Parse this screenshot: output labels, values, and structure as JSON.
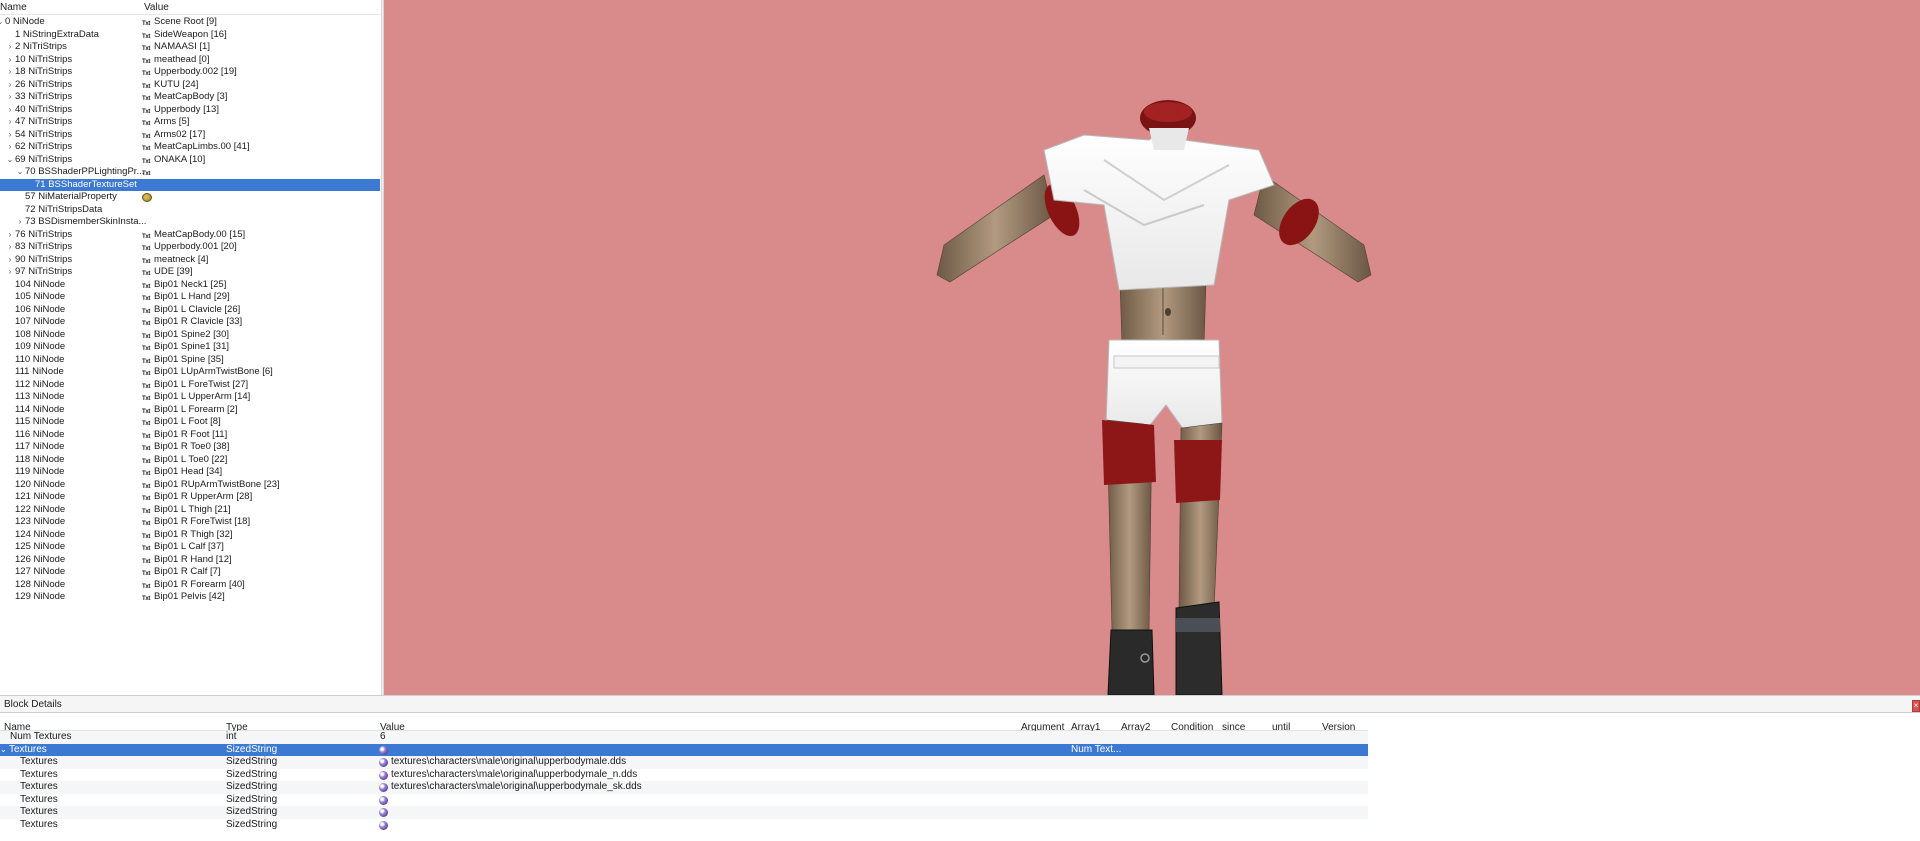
{
  "tree": {
    "columns": {
      "name": "Name",
      "value": "Value"
    },
    "rows": [
      {
        "name": "0 NiNode",
        "value": "Scene Root [9]",
        "expander": "open",
        "indent": 0,
        "icon": "txt"
      },
      {
        "name": "1 NiStringExtraData",
        "value": "SideWeapon [16]",
        "expander": "",
        "indent": 1,
        "icon": "txt"
      },
      {
        "name": "2 NiTriStrips",
        "value": "NAMAASI [1]",
        "expander": "closed",
        "indent": 1,
        "icon": "txt"
      },
      {
        "name": "10 NiTriStrips",
        "value": "meathead [0]",
        "expander": "closed",
        "indent": 1,
        "icon": "txt"
      },
      {
        "name": "18 NiTriStrips",
        "value": "Upperbody.002 [19]",
        "expander": "closed",
        "indent": 1,
        "icon": "txt"
      },
      {
        "name": "26 NiTriStrips",
        "value": "KUTU [24]",
        "expander": "closed",
        "indent": 1,
        "icon": "txt"
      },
      {
        "name": "33 NiTriStrips",
        "value": "MeatCapBody [3]",
        "expander": "closed",
        "indent": 1,
        "icon": "txt"
      },
      {
        "name": "40 NiTriStrips",
        "value": "Upperbody [13]",
        "expander": "closed",
        "indent": 1,
        "icon": "txt"
      },
      {
        "name": "47 NiTriStrips",
        "value": "Arms [5]",
        "expander": "closed",
        "indent": 1,
        "icon": "txt"
      },
      {
        "name": "54 NiTriStrips",
        "value": "Arms02 [17]",
        "expander": "closed",
        "indent": 1,
        "icon": "txt"
      },
      {
        "name": "62 NiTriStrips",
        "value": "MeatCapLimbs.00 [41]",
        "expander": "closed",
        "indent": 1,
        "icon": "txt"
      },
      {
        "name": "69 NiTriStrips",
        "value": "ONAKA [10]",
        "expander": "open",
        "indent": 1,
        "icon": "txt"
      },
      {
        "name": "70 BSShaderPPLightingPr...",
        "value": "",
        "expander": "open",
        "indent": 2,
        "icon": "txt"
      },
      {
        "name": "71 BSShaderTextureSet",
        "value": "",
        "expander": "",
        "indent": 3,
        "icon": "",
        "selected": true
      },
      {
        "name": "57 NiMaterialProperty",
        "value": "",
        "expander": "",
        "indent": 2,
        "icon": "material"
      },
      {
        "name": "72 NiTriStripsData",
        "value": "",
        "expander": "",
        "indent": 2,
        "icon": ""
      },
      {
        "name": "73 BSDismemberSkinInsta...",
        "value": "",
        "expander": "closed",
        "indent": 2,
        "icon": ""
      },
      {
        "name": "76 NiTriStrips",
        "value": "MeatCapBody.00 [15]",
        "expander": "closed",
        "indent": 1,
        "icon": "txt"
      },
      {
        "name": "83 NiTriStrips",
        "value": "Upperbody.001 [20]",
        "expander": "closed",
        "indent": 1,
        "icon": "txt"
      },
      {
        "name": "90 NiTriStrips",
        "value": "meatneck [4]",
        "expander": "closed",
        "indent": 1,
        "icon": "txt"
      },
      {
        "name": "97 NiTriStrips",
        "value": "UDE [39]",
        "expander": "closed",
        "indent": 1,
        "icon": "txt"
      },
      {
        "name": "104 NiNode",
        "value": "Bip01 Neck1 [25]",
        "expander": "",
        "indent": 1,
        "icon": "txt"
      },
      {
        "name": "105 NiNode",
        "value": "Bip01 L Hand [29]",
        "expander": "",
        "indent": 1,
        "icon": "txt"
      },
      {
        "name": "106 NiNode",
        "value": "Bip01 L Clavicle [26]",
        "expander": "",
        "indent": 1,
        "icon": "txt"
      },
      {
        "name": "107 NiNode",
        "value": "Bip01 R Clavicle [33]",
        "expander": "",
        "indent": 1,
        "icon": "txt"
      },
      {
        "name": "108 NiNode",
        "value": "Bip01 Spine2 [30]",
        "expander": "",
        "indent": 1,
        "icon": "txt"
      },
      {
        "name": "109 NiNode",
        "value": "Bip01 Spine1 [31]",
        "expander": "",
        "indent": 1,
        "icon": "txt"
      },
      {
        "name": "110 NiNode",
        "value": "Bip01 Spine [35]",
        "expander": "",
        "indent": 1,
        "icon": "txt"
      },
      {
        "name": "111 NiNode",
        "value": "Bip01 LUpArmTwistBone [6]",
        "expander": "",
        "indent": 1,
        "icon": "txt"
      },
      {
        "name": "112 NiNode",
        "value": "Bip01 L ForeTwist [27]",
        "expander": "",
        "indent": 1,
        "icon": "txt"
      },
      {
        "name": "113 NiNode",
        "value": "Bip01 L UpperArm [14]",
        "expander": "",
        "indent": 1,
        "icon": "txt"
      },
      {
        "name": "114 NiNode",
        "value": "Bip01 L Forearm [2]",
        "expander": "",
        "indent": 1,
        "icon": "txt"
      },
      {
        "name": "115 NiNode",
        "value": "Bip01 L Foot [8]",
        "expander": "",
        "indent": 1,
        "icon": "txt"
      },
      {
        "name": "116 NiNode",
        "value": "Bip01 R Foot [11]",
        "expander": "",
        "indent": 1,
        "icon": "txt"
      },
      {
        "name": "117 NiNode",
        "value": "Bip01 R Toe0 [38]",
        "expander": "",
        "indent": 1,
        "icon": "txt"
      },
      {
        "name": "118 NiNode",
        "value": "Bip01 L Toe0 [22]",
        "expander": "",
        "indent": 1,
        "icon": "txt"
      },
      {
        "name": "119 NiNode",
        "value": "Bip01 Head [34]",
        "expander": "",
        "indent": 1,
        "icon": "txt"
      },
      {
        "name": "120 NiNode",
        "value": "Bip01 RUpArmTwistBone [23]",
        "expander": "",
        "indent": 1,
        "icon": "txt"
      },
      {
        "name": "121 NiNode",
        "value": "Bip01 R UpperArm [28]",
        "expander": "",
        "indent": 1,
        "icon": "txt"
      },
      {
        "name": "122 NiNode",
        "value": "Bip01 L Thigh [21]",
        "expander": "",
        "indent": 1,
        "icon": "txt"
      },
      {
        "name": "123 NiNode",
        "value": "Bip01 R ForeTwist [18]",
        "expander": "",
        "indent": 1,
        "icon": "txt"
      },
      {
        "name": "124 NiNode",
        "value": "Bip01 R Thigh [32]",
        "expander": "",
        "indent": 1,
        "icon": "txt"
      },
      {
        "name": "125 NiNode",
        "value": "Bip01 L Calf [37]",
        "expander": "",
        "indent": 1,
        "icon": "txt"
      },
      {
        "name": "126 NiNode",
        "value": "Bip01 R Hand [12]",
        "expander": "",
        "indent": 1,
        "icon": "txt"
      },
      {
        "name": "127 NiNode",
        "value": "Bip01 R Calf [7]",
        "expander": "",
        "indent": 1,
        "icon": "txt"
      },
      {
        "name": "128 NiNode",
        "value": "Bip01 R Forearm [40]",
        "expander": "",
        "indent": 1,
        "icon": "txt"
      },
      {
        "name": "129 NiNode",
        "value": "Bip01 Pelvis [42]",
        "expander": "",
        "indent": 1,
        "icon": "txt"
      }
    ]
  },
  "value_icon_text": "Txt",
  "viewport": {
    "background": "#d98b8c"
  },
  "details": {
    "title": "Block Details",
    "columns": [
      "Name",
      "Type",
      "Value",
      "Argument",
      "Array1",
      "Array2",
      "Condition",
      "since",
      "until",
      "Version Co"
    ],
    "rows": [
      {
        "name": "Num Textures",
        "type": "int",
        "value": "6",
        "array1": "",
        "expander": "",
        "icon": ""
      },
      {
        "name": "Textures",
        "type": "SizedString",
        "value": "",
        "array1": "Num Text...",
        "expander": "open",
        "icon": "texture",
        "selected": true
      },
      {
        "name": "Textures",
        "type": "SizedString",
        "value": "textures\\characters\\male\\original\\upperbodymale.dds",
        "array1": "",
        "expander": "",
        "icon": "texture"
      },
      {
        "name": "Textures",
        "type": "SizedString",
        "value": "textures\\characters\\male\\original\\upperbodymale_n.dds",
        "array1": "",
        "expander": "",
        "icon": "texture"
      },
      {
        "name": "Textures",
        "type": "SizedString",
        "value": "textures\\characters\\male\\original\\upperbodymale_sk.dds",
        "array1": "",
        "expander": "",
        "icon": "texture"
      },
      {
        "name": "Textures",
        "type": "SizedString",
        "value": "",
        "array1": "",
        "expander": "",
        "icon": "texture"
      },
      {
        "name": "Textures",
        "type": "SizedString",
        "value": "",
        "array1": "",
        "expander": "",
        "icon": "texture"
      },
      {
        "name": "Textures",
        "type": "SizedString",
        "value": "",
        "array1": "",
        "expander": "",
        "icon": "texture"
      }
    ]
  },
  "colors": {
    "selection": "#3b79d2",
    "viewport_bg": "#d98b8c",
    "close_button": "#d9534f"
  }
}
